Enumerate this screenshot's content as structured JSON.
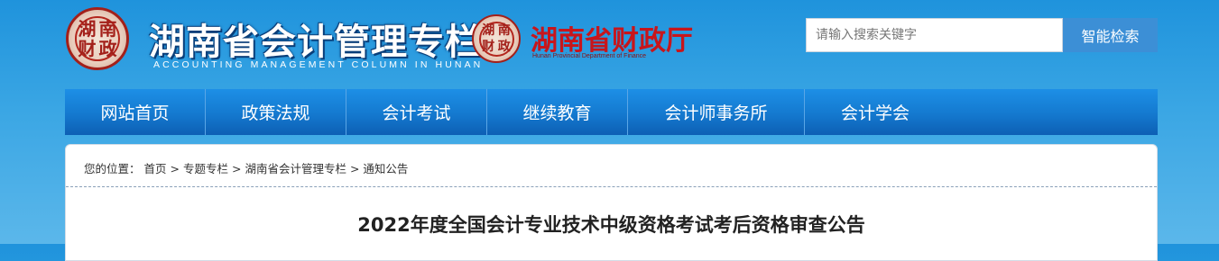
{
  "header": {
    "seal_main_chars": [
      "湖",
      "南",
      "财",
      "政"
    ],
    "site_title": "湖南省会计管理专栏",
    "site_subtitle": "ACCOUNTING MANAGEMENT COLUMN IN HUNAN",
    "seal_small_chars": [
      "湖",
      "南",
      "财",
      "政"
    ],
    "dept_name": "湖南省财政厅",
    "dept_name_en": "Hunan Provincial Department of Finance"
  },
  "search": {
    "placeholder": "请输入搜索关键字",
    "value": "",
    "button_label": "智能检索"
  },
  "nav": {
    "items": [
      {
        "label": "网站首页"
      },
      {
        "label": "政策法规"
      },
      {
        "label": "会计考试"
      },
      {
        "label": "继续教育"
      },
      {
        "label": "会计师事务所"
      },
      {
        "label": "会计学会"
      }
    ]
  },
  "breadcrumb": {
    "prefix": "您的位置：",
    "separator": ">",
    "items": [
      "首页",
      "专题专栏",
      "湖南省会计管理专栏",
      "通知公告"
    ]
  },
  "article": {
    "title": "2022年度全国会计专业技术中级资格考试考后资格审查公告"
  },
  "colors": {
    "header_bg": "#1f93dc",
    "nav_bg": "#1479cf",
    "search_button": "#3c8fd6",
    "dept_red": "#c8151b"
  }
}
